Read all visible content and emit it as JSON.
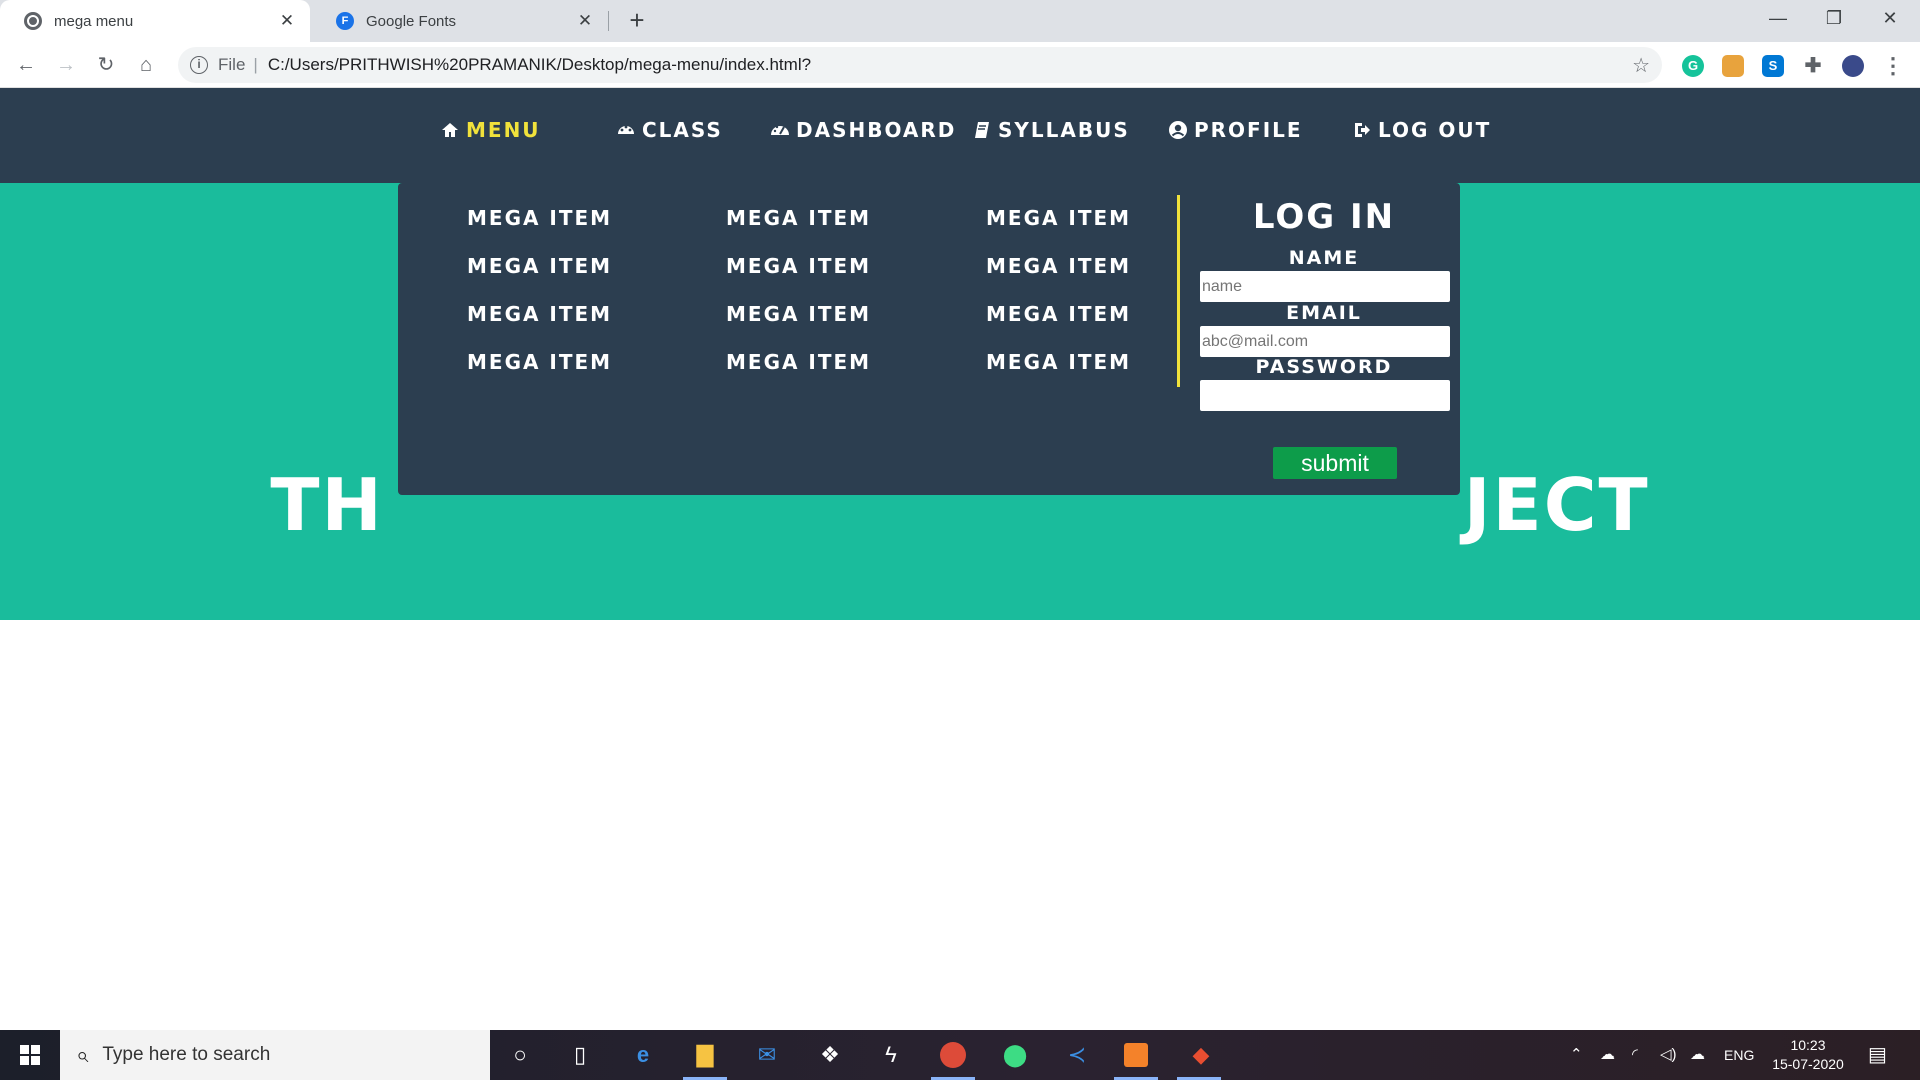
{
  "browser": {
    "tabs": [
      {
        "title": "mega menu",
        "active": true
      },
      {
        "title": "Google Fonts",
        "active": false,
        "favicon_letter": "F"
      }
    ],
    "new_tab_symbol": "+",
    "address": {
      "scheme_label": "File",
      "url": "C:/Users/PRITHWISH%20PRAMANIK/Desktop/mega-menu/index.html?"
    },
    "window_controls": [
      "minimize-icon",
      "restore-icon",
      "close-icon"
    ],
    "extensions": [
      {
        "name": "grammarly-icon",
        "color": "#15c39a",
        "letter": "G"
      },
      {
        "name": "cast-icon",
        "color": "#e8a33d",
        "letter": ""
      },
      {
        "name": "skype-icon",
        "color": "#0078d4",
        "letter": "S"
      },
      {
        "name": "puzzle-icon",
        "color": "#5f6368",
        "letter": ""
      },
      {
        "name": "profile-avatar-icon",
        "color": "#3a4a8a",
        "letter": ""
      }
    ]
  },
  "page": {
    "nav": [
      {
        "label": "MENU",
        "icon": "home-icon",
        "active": true
      },
      {
        "label": "CLASS",
        "icon": "palette-icon",
        "active": false
      },
      {
        "label": "DASHBOARD",
        "icon": "dashboard-icon",
        "active": false
      },
      {
        "label": "SYLLABUS",
        "icon": "book-icon",
        "active": false
      },
      {
        "label": "PROFILE",
        "icon": "user-circle-icon",
        "active": false
      },
      {
        "label": "LOG OUT",
        "icon": "sign-out-icon",
        "active": false
      }
    ],
    "hero": {
      "title_left": "TH",
      "title_right": "JECT"
    },
    "mega_menu": {
      "columns": [
        [
          "MEGA ITEM",
          "MEGA ITEM",
          "MEGA ITEM",
          "MEGA ITEM"
        ],
        [
          "MEGA ITEM",
          "MEGA ITEM",
          "MEGA ITEM",
          "MEGA ITEM"
        ],
        [
          "MEGA ITEM",
          "MEGA ITEM",
          "MEGA ITEM",
          "MEGA ITEM"
        ]
      ]
    },
    "login": {
      "title": "LOG IN",
      "name_label": "NAME",
      "name_placeholder": "name",
      "email_label": "EMAIL",
      "email_placeholder": "abc@mail.com",
      "password_label": "PASSWORD",
      "submit_label": "submit"
    },
    "colors": {
      "nav_bg": "#2c3e50",
      "hero_bg": "#1abc9c",
      "active_nav": "#f1e23b",
      "submit_bg": "#0d9c4a"
    }
  },
  "taskbar": {
    "search_placeholder": "Type here to search",
    "apps": [
      "cortana-icon",
      "task-view-icon",
      "edge-icon",
      "file-explorer-icon",
      "mail-icon",
      "dropbox-icon",
      "app-s-icon",
      "chrome-icon",
      "maps-icon",
      "vscode-icon",
      "sublime-icon",
      "git-icon"
    ],
    "language": "ENG",
    "time": "10:23",
    "date": "15-07-2020"
  }
}
